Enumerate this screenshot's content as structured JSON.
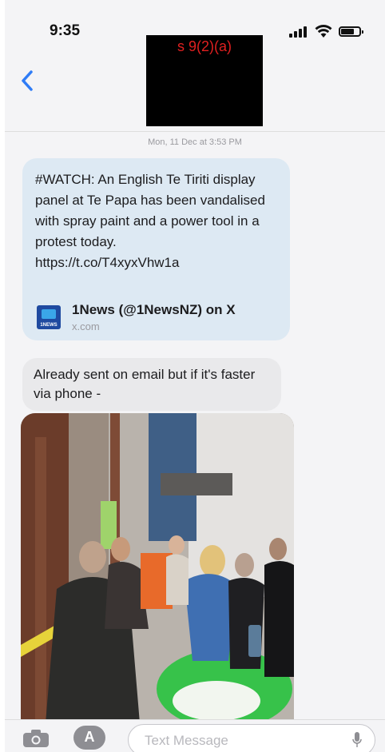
{
  "status_bar": {
    "time": "9:35"
  },
  "header": {
    "redaction_label": "s 9(2)(a)"
  },
  "thread": {
    "timestamp": "Mon, 11 Dec at 3:53 PM",
    "messages": [
      {
        "text": "#WATCH: An English Te Tiriti display panel at Te Papa has been vandalised with spray paint and a power tool in a protest today.\nhttps://t.co/T4xyxVhw1a",
        "link_preview": {
          "title": "1News (@1NewsNZ) on X",
          "domain": "x.com",
          "icon": "1news-logo-icon",
          "icon_text": "1NEWS"
        }
      },
      {
        "text": "Already sent on email but if it's faster via phone -"
      },
      {
        "attachment": "photo",
        "icon": "photo-attachment"
      }
    ]
  },
  "input_bar": {
    "placeholder": "Text Message"
  },
  "colors": {
    "accent": "#2f7cf6",
    "incoming_bubble": "#e9e9eb",
    "link_bubble": "#dde9f3",
    "redaction": "#000000",
    "redaction_text": "#e02020"
  }
}
